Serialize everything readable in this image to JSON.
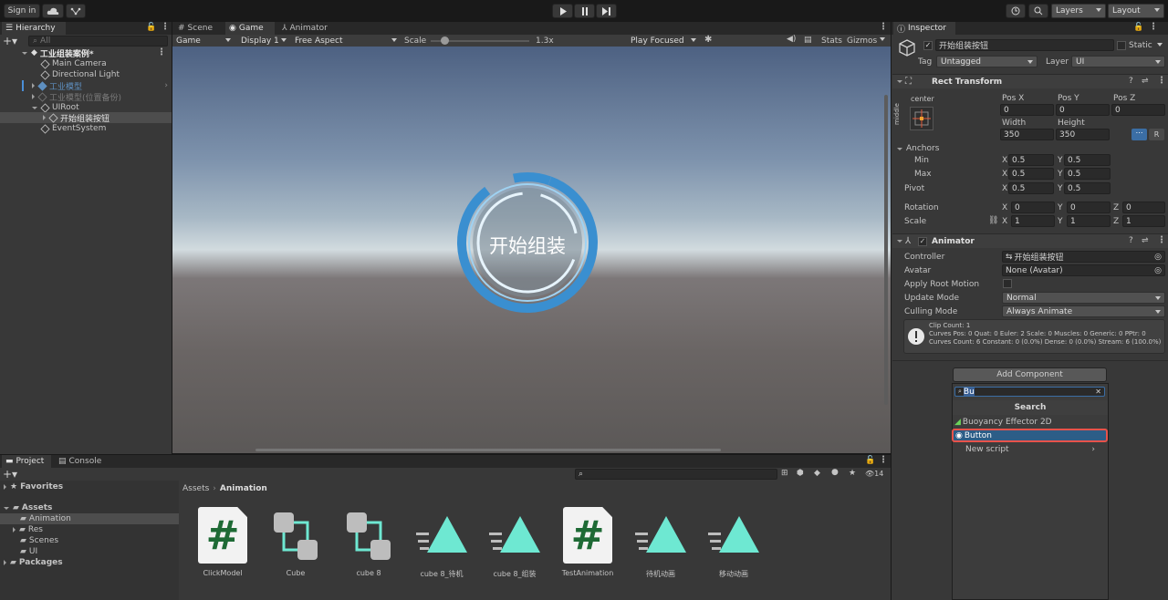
{
  "toolbar": {
    "sign_in": "Sign in",
    "cloud_icon": "cloud-icon",
    "collab_icon": "collab-icon",
    "layers": "Layers",
    "layout": "Layout"
  },
  "hierarchy": {
    "tab": "Hierarchy",
    "search_placeholder": "All",
    "scene": "工业组装案例*",
    "items": [
      "Main Camera",
      "Directional Light",
      "工业模型",
      "工业模型(位置备份)",
      "UIRoot",
      "开始组装按钮",
      "EventSystem"
    ]
  },
  "view_tabs": {
    "scene": "Scene",
    "game": "Game",
    "animator": "Animator"
  },
  "game_bar": {
    "mode": "Game",
    "display": "Display 1",
    "aspect": "Free Aspect",
    "scale_label": "Scale",
    "scale_value": "1.3x",
    "play_focused": "Play Focused",
    "stats": "Stats",
    "gizmos": "Gizmos"
  },
  "game_view": {
    "button_text": "开始组装"
  },
  "inspector": {
    "tab": "Inspector",
    "object_name": "开始组装按钮",
    "static": "Static",
    "tag_label": "Tag",
    "tag_value": "Untagged",
    "layer_label": "Layer",
    "layer_value": "UI",
    "rect_transform": {
      "title": "Rect Transform",
      "center": "center",
      "middle": "middle",
      "pos_x_label": "Pos X",
      "pos_y_label": "Pos Y",
      "pos_z_label": "Pos Z",
      "pos_x": "0",
      "pos_y": "0",
      "pos_z": "0",
      "width_label": "Width",
      "height_label": "Height",
      "width": "350",
      "height": "350",
      "r_btn": "R",
      "anchors": "Anchors",
      "min": "Min",
      "max": "Max",
      "pivot": "Pivot",
      "x": "X",
      "y": "Y",
      "z": "Z",
      "min_x": "0.5",
      "min_y": "0.5",
      "max_x": "0.5",
      "max_y": "0.5",
      "pivot_x": "0.5",
      "pivot_y": "0.5",
      "rotation": "Rotation",
      "rot_x": "0",
      "rot_y": "0",
      "rot_z": "0",
      "scale": "Scale",
      "scale_x": "1",
      "scale_y": "1",
      "scale_z": "1"
    },
    "animator": {
      "title": "Animator",
      "controller_label": "Controller",
      "controller_value": "开始组装按钮",
      "avatar_label": "Avatar",
      "avatar_value": "None (Avatar)",
      "apply_root_motion": "Apply Root Motion",
      "update_mode_label": "Update Mode",
      "update_mode_value": "Normal",
      "culling_mode_label": "Culling Mode",
      "culling_mode_value": "Always Animate",
      "info_line1": "Clip Count: 1",
      "info_line2": "Curves Pos: 0 Quat: 0 Euler: 2 Scale: 0 Muscles: 0 Generic: 0 PPtr: 0",
      "info_line3": "Curves Count: 6 Constant: 0 (0.0%) Dense: 0 (0.0%) Stream: 6 (100.0%)"
    },
    "add_component": "Add Component",
    "search_value": "Bu",
    "search_header": "Search",
    "results": [
      "Buoyancy Effector 2D",
      "Button",
      "New script"
    ]
  },
  "project": {
    "tab_project": "Project",
    "tab_console": "Console",
    "favorites": "Favorites",
    "assets": "Assets",
    "folders": [
      "Animation",
      "Res",
      "Scenes",
      "UI"
    ],
    "packages": "Packages",
    "breadcrumb_root": "Assets",
    "breadcrumb_current": "Animation",
    "hidden_count": "14",
    "files": [
      {
        "name": "ClickModel",
        "kind": "script"
      },
      {
        "name": "Cube",
        "kind": "controller"
      },
      {
        "name": "cube 8",
        "kind": "controller"
      },
      {
        "name": "cube 8_待机",
        "kind": "clip"
      },
      {
        "name": "cube 8_组装",
        "kind": "clip"
      },
      {
        "name": "TestAnimation",
        "kind": "script"
      },
      {
        "name": "待机动画",
        "kind": "clip"
      },
      {
        "name": "移动动画",
        "kind": "clip"
      }
    ]
  },
  "colors": {
    "accent": "#2c5d87",
    "highlight": "#e8524a",
    "clip": "#6ee8d2",
    "game_button": "#3a8fd0"
  }
}
